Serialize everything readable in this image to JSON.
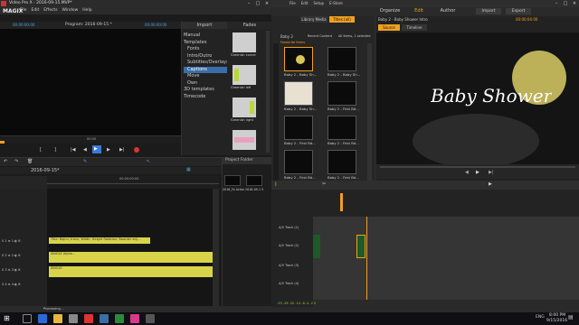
{
  "left_app": {
    "title": "Video Pro X - 2016-09-15.MVP*",
    "brand": "MAGIX",
    "menu": [
      "File",
      "Edit",
      "Effects",
      "Window",
      "Help"
    ],
    "program_label": "Program: 2016-09-15 *",
    "program_tc_left": "00:00:00:00",
    "program_tc_right": "00:00:00:00",
    "preview_tc": "00:00",
    "import_tab": "Import",
    "fades_tab": "Fades",
    "tree": [
      "Manual",
      "Templates",
      "Fonts",
      "Intro/Outro",
      "Subtitles/Overlays",
      "Captions",
      "Move",
      "Own",
      "3D templates",
      "Timecode"
    ],
    "templates": [
      {
        "label": "Greenish corner"
      },
      {
        "label": "Greenish left"
      },
      {
        "label": "Greenish right"
      },
      {
        "label": ""
      }
    ],
    "project_name": "2016-09-15*",
    "project_folder_title": "Project Folder",
    "pf_items": [
      {
        "label": "2016_Fa Action..."
      },
      {
        "label": "2016-09-1 5"
      }
    ],
    "timeline_tc": "00:00:00:00",
    "clips": [
      "Title: Bajnu; trans; Width; Height Rotation; Boarder adj...",
      "SINGLE Alpha...",
      "SINGLE"
    ],
    "track_labels": [
      "S 1 ≡ 1 ◐ 6",
      "S 2 ≡ 2 ◐ 6",
      "S 3 ≡ 3 ◐ 6",
      "S 4 ≡ 4 ◐ 6"
    ],
    "status_text": "Processing..."
  },
  "right_app": {
    "menu": [
      "File",
      "Edit",
      "Setup",
      "E-Store"
    ],
    "nav_tabs": [
      "Organize",
      "Edit",
      "Author"
    ],
    "nav_actions": [
      "Import",
      "Export"
    ],
    "lib_tabs": [
      "Library Media",
      "Titles (all)"
    ],
    "sub_tabs": [
      "Baby 2",
      "Recent Content",
      "All items, 1 selected"
    ],
    "rating_label": "Favourite Items",
    "library_items": [
      {
        "label": "Baby 2 - Baby Sh..."
      },
      {
        "label": "Baby 2 - Baby Sh..."
      },
      {
        "label": "Baby 2 - Baby Sh..."
      },
      {
        "label": "Baby 2 - First Bd..."
      },
      {
        "label": "Baby 2 - First Bd..."
      },
      {
        "label": "Baby 2 - First Bd..."
      },
      {
        "label": "Baby 2 - First Bd..."
      },
      {
        "label": "Baby 2 - First Bd..."
      }
    ],
    "preview_title": "Baby 2 - Baby Shower Intro",
    "preview_tc": "00:00:04:00",
    "source_tab": "Source",
    "timeline_tab": "Timeline",
    "preview_text": "Baby Shower",
    "track_names": [
      "A/V Track (1)",
      "A/V Track (2)",
      "A/V Track (3)",
      "A/V Track (4)"
    ],
    "zoom_label": "I",
    "bottom_ruler": "-33 -26 -20 -14 -8 -4 -2 0"
  },
  "taskbar": {
    "time": "8:00 PM",
    "date": "9/15/2016",
    "lang": "ENG"
  },
  "colors": {
    "accent_orange": "#f0a020",
    "clip_yellow": "#d8d44a",
    "title_bg": "#2b2b2b",
    "preview_bg": "#141414"
  }
}
